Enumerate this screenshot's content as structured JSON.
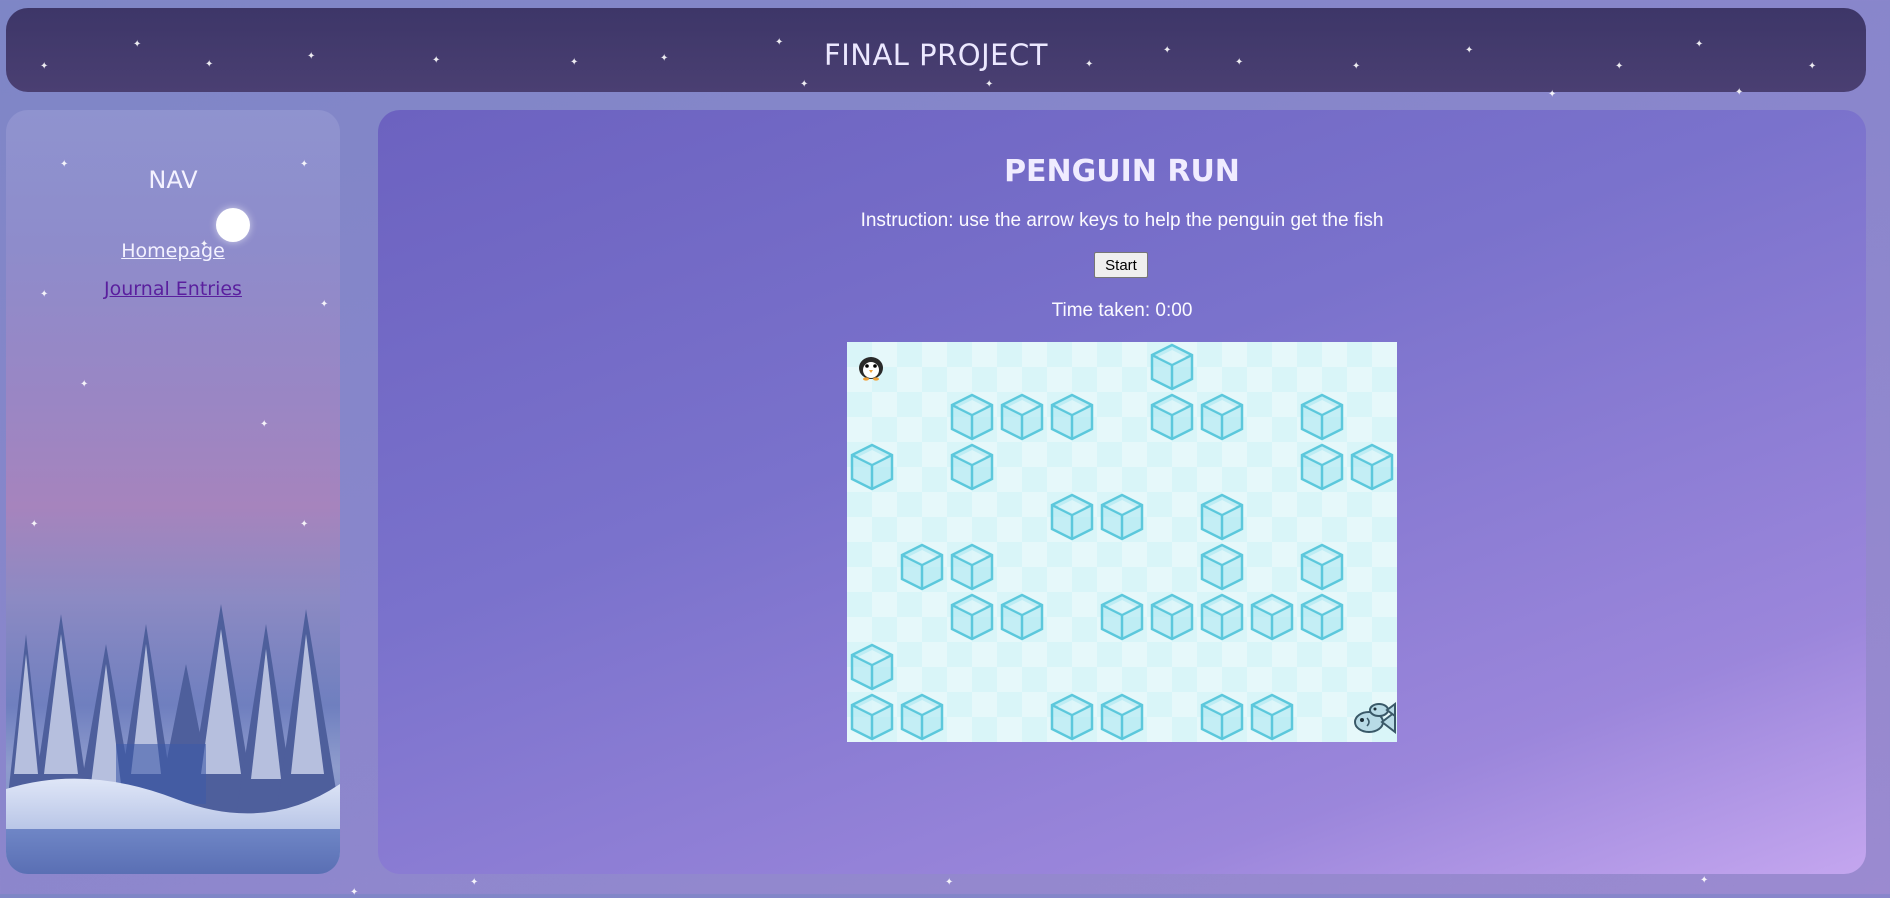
{
  "header": {
    "title": "FINAL PROJECT"
  },
  "nav": {
    "title": "NAV",
    "links": [
      {
        "label": "Homepage"
      },
      {
        "label": "Journal Entries"
      }
    ]
  },
  "game": {
    "title": "PENGUIN RUN",
    "instruction": "Instruction: use the arrow keys to help the penguin get the fish",
    "start_label": "Start",
    "time_text": "Time taken: 0:00",
    "grid": {
      "cols": 11,
      "rows": 8
    },
    "player": {
      "name": "penguin",
      "col": 0,
      "row": 0
    },
    "goal": {
      "name": "fish",
      "col": 10,
      "row": 7
    },
    "ice_blocks": [
      [
        6,
        0
      ],
      [
        2,
        1
      ],
      [
        3,
        1
      ],
      [
        4,
        1
      ],
      [
        6,
        1
      ],
      [
        7,
        1
      ],
      [
        9,
        1
      ],
      [
        0,
        2
      ],
      [
        2,
        2
      ],
      [
        9,
        2
      ],
      [
        10,
        2
      ],
      [
        4,
        3
      ],
      [
        5,
        3
      ],
      [
        7,
        3
      ],
      [
        1,
        4
      ],
      [
        2,
        4
      ],
      [
        7,
        4
      ],
      [
        9,
        4
      ],
      [
        2,
        5
      ],
      [
        3,
        5
      ],
      [
        5,
        5
      ],
      [
        6,
        5
      ],
      [
        7,
        5
      ],
      [
        8,
        5
      ],
      [
        9,
        5
      ],
      [
        0,
        6
      ],
      [
        0,
        7
      ],
      [
        1,
        7
      ],
      [
        4,
        7
      ],
      [
        5,
        7
      ],
      [
        7,
        7
      ],
      [
        8,
        7
      ]
    ]
  },
  "colors": {
    "header_bg": "#453d6e",
    "panel_bg": "#7a72cc",
    "ice_fill": "#a8e6f0",
    "ice_stroke": "#5cc8dc",
    "board_bg": "#d9f5f8"
  }
}
